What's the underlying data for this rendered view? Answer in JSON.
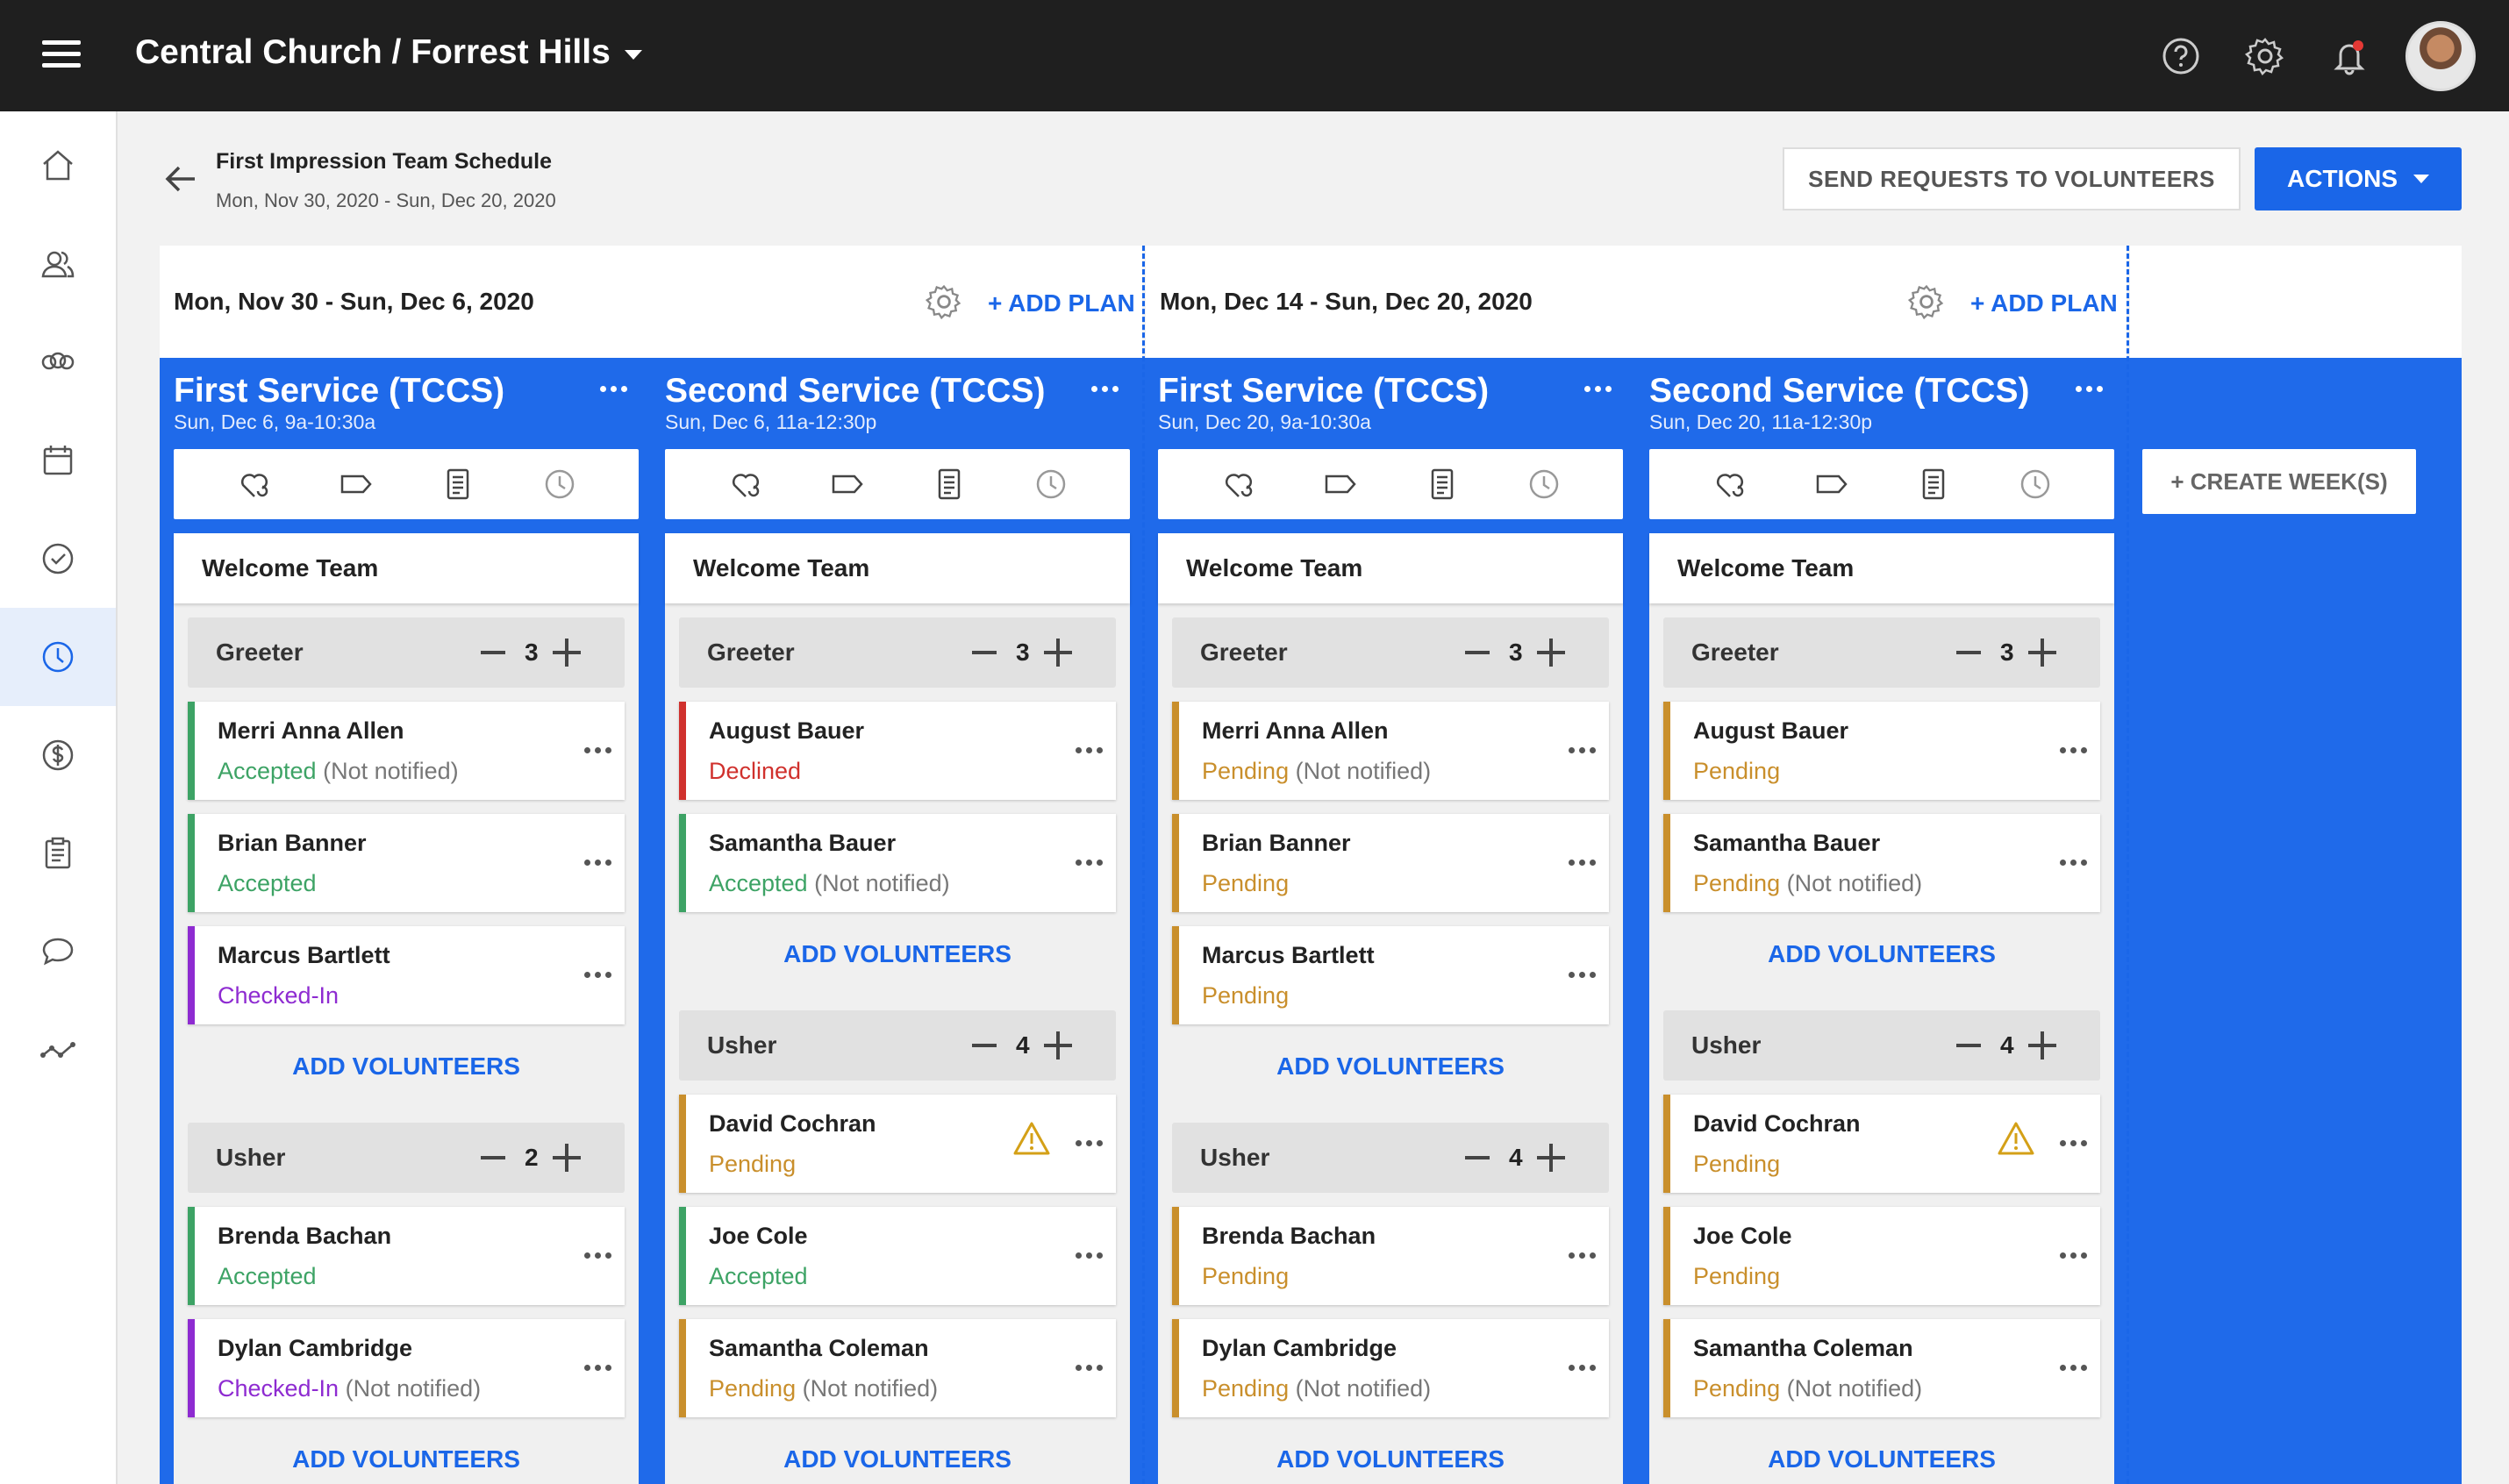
{
  "header": {
    "org_title": "Central Church / Forrest Hills"
  },
  "page": {
    "title": "First Impression Team Schedule",
    "date_range": "Mon, Nov 30, 2020 - Sun, Dec 20, 2020",
    "send_requests_label": "SEND REQUESTS TO VOLUNTEERS",
    "actions_label": "ACTIONS",
    "create_weeks_label": "+ CREATE WEEK(S)"
  },
  "weeks": [
    {
      "label": "Mon, Nov 30 - Sun, Dec 6, 2020",
      "add_plan": "+ ADD PLAN"
    },
    {
      "label": "Mon, Dec 14 - Sun, Dec 20, 2020",
      "add_plan": "+ ADD PLAN"
    }
  ],
  "colors": {
    "accent": "#1a66e8",
    "accepted": "#3da365",
    "pending": "#c98f2c",
    "declined": "#d0312d",
    "checked_in": "#8e2bd1",
    "background_blue": "#1f6aea"
  },
  "columns": [
    {
      "title": "First Service (TCCS)",
      "subtitle": "Sun, Dec 6, 9a-10:30a",
      "team": "Welcome Team",
      "roles": [
        {
          "name": "Greeter",
          "count": "3",
          "volunteers": [
            {
              "name": "Merri Anna Allen",
              "status": "Accepted",
              "note": " (Not notified)",
              "kind": "accepted",
              "warn": false
            },
            {
              "name": "Brian Banner",
              "status": "Accepted",
              "note": "",
              "kind": "accepted",
              "warn": false
            },
            {
              "name": "Marcus Bartlett",
              "status": "Checked-In",
              "note": "",
              "kind": "checked_in",
              "warn": false
            }
          ],
          "add_label": "ADD VOLUNTEERS"
        },
        {
          "name": "Usher",
          "count": "2",
          "volunteers": [
            {
              "name": "Brenda Bachan",
              "status": "Accepted",
              "note": "",
              "kind": "accepted",
              "warn": false
            },
            {
              "name": "Dylan Cambridge",
              "status": "Checked-In",
              "note": " (Not notified)",
              "kind": "checked_in",
              "warn": false
            }
          ],
          "add_label": "ADD VOLUNTEERS"
        }
      ]
    },
    {
      "title": "Second Service (TCCS)",
      "subtitle": "Sun, Dec 6, 11a-12:30p",
      "team": "Welcome Team",
      "roles": [
        {
          "name": "Greeter",
          "count": "3",
          "volunteers": [
            {
              "name": "August Bauer",
              "status": "Declined",
              "note": "",
              "kind": "declined",
              "warn": false
            },
            {
              "name": "Samantha Bauer",
              "status": "Accepted",
              "note": " (Not notified)",
              "kind": "accepted",
              "warn": false
            }
          ],
          "add_label": "ADD VOLUNTEERS"
        },
        {
          "name": "Usher",
          "count": "4",
          "volunteers": [
            {
              "name": "David Cochran",
              "status": "Pending",
              "note": "",
              "kind": "pending",
              "warn": true
            },
            {
              "name": "Joe Cole",
              "status": "Accepted",
              "note": "",
              "kind": "accepted",
              "warn": false
            },
            {
              "name": "Samantha Coleman",
              "status": "Pending",
              "note": " (Not notified)",
              "kind": "pending",
              "warn": false
            }
          ],
          "add_label": "ADD VOLUNTEERS"
        }
      ]
    },
    {
      "title": "First Service (TCCS)",
      "subtitle": "Sun, Dec 20, 9a-10:30a",
      "team": "Welcome Team",
      "roles": [
        {
          "name": "Greeter",
          "count": "3",
          "volunteers": [
            {
              "name": "Merri Anna Allen",
              "status": "Pending",
              "note": " (Not notified)",
              "kind": "pending",
              "warn": false
            },
            {
              "name": "Brian Banner",
              "status": "Pending",
              "note": "",
              "kind": "pending",
              "warn": false
            },
            {
              "name": "Marcus Bartlett",
              "status": "Pending",
              "note": "",
              "kind": "pending",
              "warn": false
            }
          ],
          "add_label": "ADD VOLUNTEERS"
        },
        {
          "name": "Usher",
          "count": "4",
          "volunteers": [
            {
              "name": "Brenda Bachan",
              "status": "Pending",
              "note": "",
              "kind": "pending",
              "warn": false
            },
            {
              "name": "Dylan Cambridge",
              "status": "Pending",
              "note": " (Not notified)",
              "kind": "pending",
              "warn": false
            }
          ],
          "add_label": "ADD VOLUNTEERS"
        }
      ]
    },
    {
      "title": "Second Service (TCCS)",
      "subtitle": "Sun, Dec 20, 11a-12:30p",
      "team": "Welcome Team",
      "roles": [
        {
          "name": "Greeter",
          "count": "3",
          "volunteers": [
            {
              "name": "August Bauer",
              "status": "Pending",
              "note": "",
              "kind": "pending",
              "warn": false
            },
            {
              "name": "Samantha Bauer",
              "status": "Pending",
              "note": " (Not notified)",
              "kind": "pending",
              "warn": false
            }
          ],
          "add_label": "ADD VOLUNTEERS"
        },
        {
          "name": "Usher",
          "count": "4",
          "volunteers": [
            {
              "name": "David Cochran",
              "status": "Pending",
              "note": "",
              "kind": "pending",
              "warn": true
            },
            {
              "name": "Joe Cole",
              "status": "Pending",
              "note": "",
              "kind": "pending",
              "warn": false
            },
            {
              "name": "Samantha Coleman",
              "status": "Pending",
              "note": " (Not notified)",
              "kind": "pending",
              "warn": false
            }
          ],
          "add_label": "ADD VOLUNTEERS"
        }
      ]
    }
  ]
}
